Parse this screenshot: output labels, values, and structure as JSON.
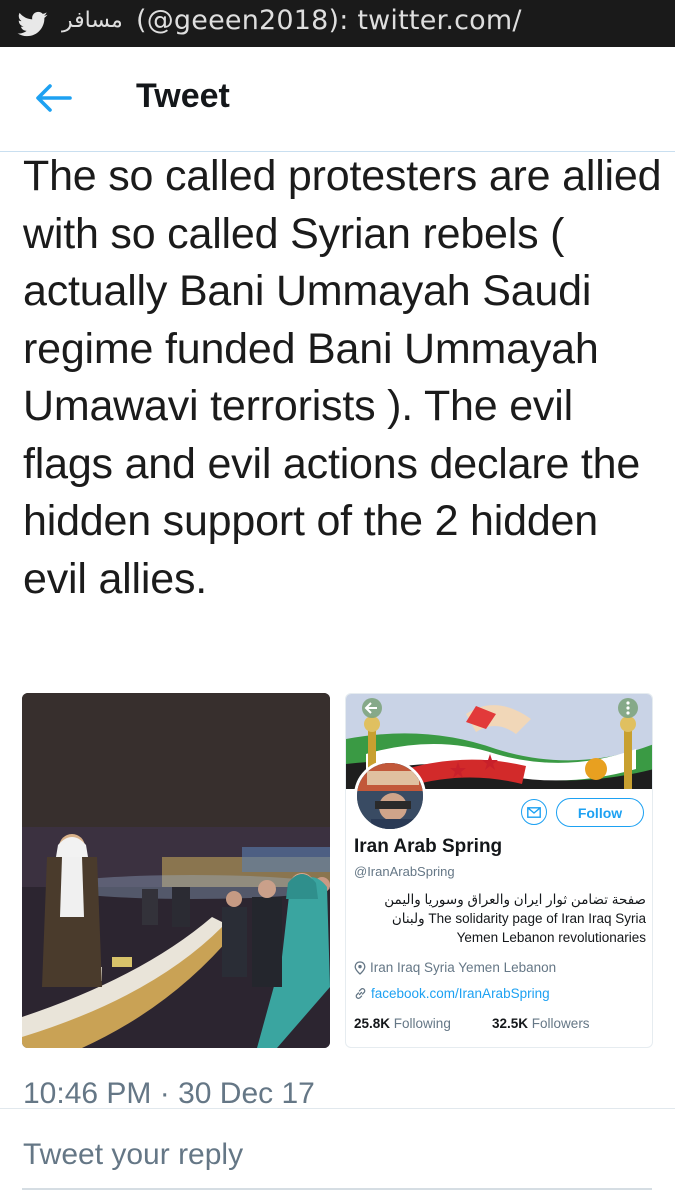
{
  "status_bar": {
    "account_name": "مسافر",
    "handle_url": "(@geeen2018): twitter.com/"
  },
  "header": {
    "title": "Tweet"
  },
  "tweet": {
    "text": "The so called protesters are allied with so called Syrian rebels ( actually Bani Ummayah Saudi regime funded Bani Ummayah Umawavi terrorists ). The evil flags and evil actions declare the hidden support of the 2 hidden evil allies.",
    "timestamp": "10:46 PM · 30 Dec 17"
  },
  "profile_card": {
    "follow_label": "Follow",
    "name": "Iran Arab Spring",
    "handle": "@IranArabSpring",
    "bio": "صفحة تضامن ثوار ايران والعراق وسوريا واليمن ولبنان The solidarity page of Iran Iraq Syria Yemen Lebanon revolutionaries",
    "location": "Iran Iraq Syria Yemen Lebanon",
    "link": "facebook.com/IranArabSpring",
    "following_count": "25.8K",
    "following_label": "Following",
    "followers_count": "32.5K",
    "followers_label": "Followers"
  },
  "reply": {
    "placeholder": "Tweet your reply"
  },
  "colors": {
    "accent": "#1da1f2",
    "muted": "#657786"
  }
}
